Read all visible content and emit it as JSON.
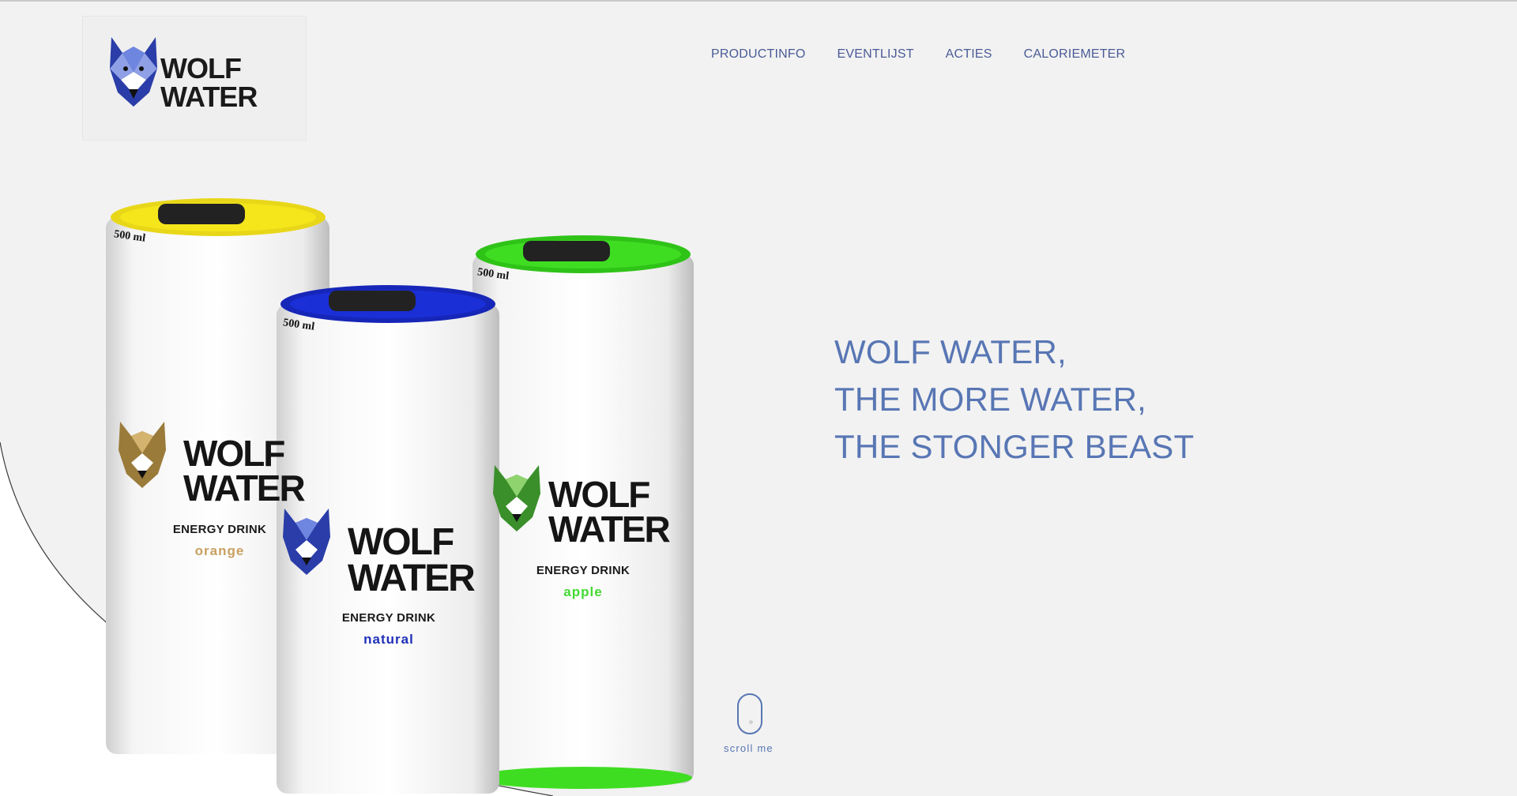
{
  "logo": {
    "line1": "WOLF",
    "line2": "WATER"
  },
  "nav": {
    "items": [
      "PRODUCTINFO",
      "EVENTLIJST",
      "ACTIES",
      "CALORIEMETER"
    ]
  },
  "products": [
    {
      "brand_line1": "WOLF",
      "brand_line2": "WATER",
      "energy": "ENERGY DRINK",
      "flavor": "orange",
      "volume": "500 ml",
      "cap_color": "#f5e61b",
      "flavor_color": "#c8a060"
    },
    {
      "brand_line1": "WOLF",
      "brand_line2": "WATER",
      "energy": "ENERGY DRINK",
      "flavor": "natural",
      "volume": "500 ml",
      "cap_color": "#1a2fd6",
      "flavor_color": "#1f2fb8"
    },
    {
      "brand_line1": "WOLF",
      "brand_line2": "WATER",
      "energy": "ENERGY DRINK",
      "flavor": "apple",
      "volume": "500 ml",
      "cap_color": "#3fdd22",
      "flavor_color": "#44d933"
    }
  ],
  "headline": {
    "line1": "WOLF WATER,",
    "line2": "THE MORE WATER,",
    "line3": "THE STONGER BEAST"
  },
  "scroll": {
    "label": "scroll me"
  },
  "colors": {
    "accent": "#5876b4",
    "nav": "#4a5b96",
    "background": "#f2f2f2"
  }
}
